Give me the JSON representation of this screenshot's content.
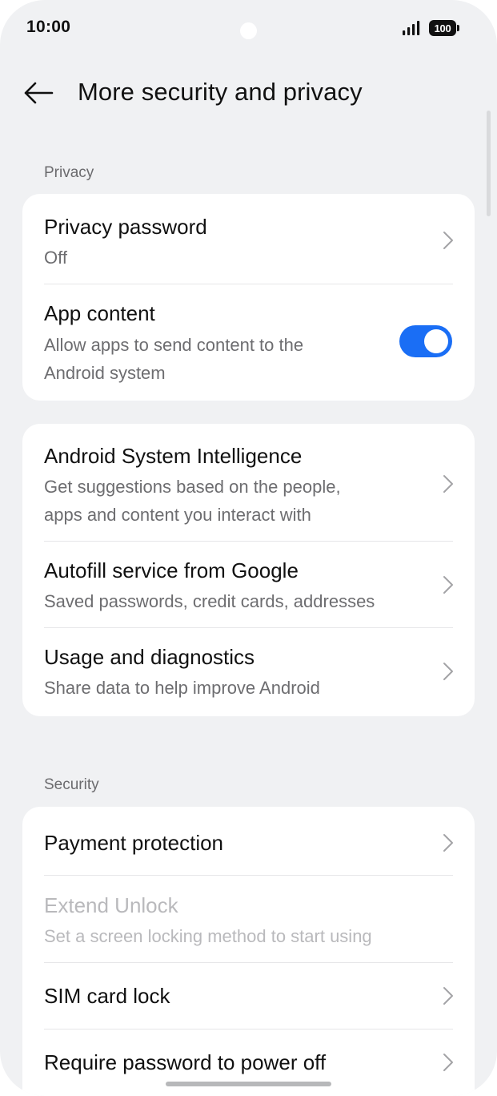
{
  "status_bar": {
    "time": "10:00",
    "battery": "100"
  },
  "header": {
    "title": "More security and privacy"
  },
  "sections": {
    "privacy": {
      "label": "Privacy"
    },
    "security": {
      "label": "Security"
    }
  },
  "privacy_card": {
    "privacy_password": {
      "title": "Privacy password",
      "subtitle": "Off"
    },
    "app_content": {
      "title": "App content",
      "subtitle_line1": "Allow apps to send content to the",
      "subtitle_line2": "Android system",
      "toggle_on": true
    }
  },
  "android_card": {
    "asi": {
      "title": "Android System Intelligence",
      "subtitle_line1": "Get suggestions based on the people,",
      "subtitle_line2": "apps and content you interact with"
    },
    "autofill": {
      "title": "Autofill service from Google",
      "subtitle": "Saved passwords, credit cards, addresses"
    },
    "usage": {
      "title": "Usage and diagnostics",
      "subtitle": "Share data to help improve Android"
    }
  },
  "security_card": {
    "payment": {
      "title": "Payment protection"
    },
    "extend_unlock": {
      "title": "Extend Unlock",
      "subtitle": "Set a screen locking method to start using",
      "disabled": true
    },
    "sim_lock": {
      "title": "SIM card lock"
    },
    "power_off": {
      "title": "Require password to power off"
    }
  },
  "colors": {
    "accent": "#1a6ef5",
    "background": "#f0f1f3",
    "card": "#ffffff"
  }
}
